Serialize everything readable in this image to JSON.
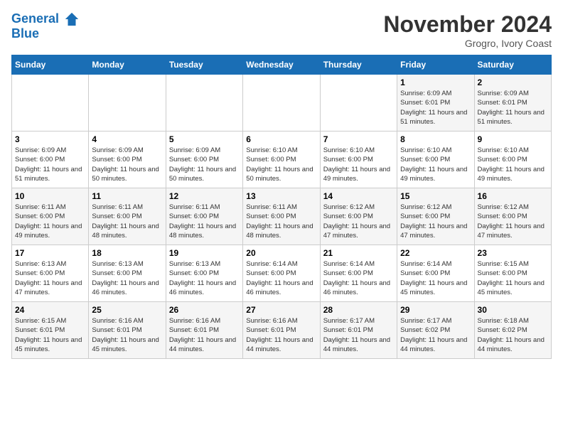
{
  "logo": {
    "line1": "General",
    "line2": "Blue"
  },
  "title": "November 2024",
  "subtitle": "Grogro, Ivory Coast",
  "days_of_week": [
    "Sunday",
    "Monday",
    "Tuesday",
    "Wednesday",
    "Thursday",
    "Friday",
    "Saturday"
  ],
  "weeks": [
    [
      {
        "day": "",
        "detail": ""
      },
      {
        "day": "",
        "detail": ""
      },
      {
        "day": "",
        "detail": ""
      },
      {
        "day": "",
        "detail": ""
      },
      {
        "day": "",
        "detail": ""
      },
      {
        "day": "1",
        "detail": "Sunrise: 6:09 AM\nSunset: 6:01 PM\nDaylight: 11 hours and 51 minutes."
      },
      {
        "day": "2",
        "detail": "Sunrise: 6:09 AM\nSunset: 6:01 PM\nDaylight: 11 hours and 51 minutes."
      }
    ],
    [
      {
        "day": "3",
        "detail": "Sunrise: 6:09 AM\nSunset: 6:00 PM\nDaylight: 11 hours and 51 minutes."
      },
      {
        "day": "4",
        "detail": "Sunrise: 6:09 AM\nSunset: 6:00 PM\nDaylight: 11 hours and 50 minutes."
      },
      {
        "day": "5",
        "detail": "Sunrise: 6:09 AM\nSunset: 6:00 PM\nDaylight: 11 hours and 50 minutes."
      },
      {
        "day": "6",
        "detail": "Sunrise: 6:10 AM\nSunset: 6:00 PM\nDaylight: 11 hours and 50 minutes."
      },
      {
        "day": "7",
        "detail": "Sunrise: 6:10 AM\nSunset: 6:00 PM\nDaylight: 11 hours and 49 minutes."
      },
      {
        "day": "8",
        "detail": "Sunrise: 6:10 AM\nSunset: 6:00 PM\nDaylight: 11 hours and 49 minutes."
      },
      {
        "day": "9",
        "detail": "Sunrise: 6:10 AM\nSunset: 6:00 PM\nDaylight: 11 hours and 49 minutes."
      }
    ],
    [
      {
        "day": "10",
        "detail": "Sunrise: 6:11 AM\nSunset: 6:00 PM\nDaylight: 11 hours and 49 minutes."
      },
      {
        "day": "11",
        "detail": "Sunrise: 6:11 AM\nSunset: 6:00 PM\nDaylight: 11 hours and 48 minutes."
      },
      {
        "day": "12",
        "detail": "Sunrise: 6:11 AM\nSunset: 6:00 PM\nDaylight: 11 hours and 48 minutes."
      },
      {
        "day": "13",
        "detail": "Sunrise: 6:11 AM\nSunset: 6:00 PM\nDaylight: 11 hours and 48 minutes."
      },
      {
        "day": "14",
        "detail": "Sunrise: 6:12 AM\nSunset: 6:00 PM\nDaylight: 11 hours and 47 minutes."
      },
      {
        "day": "15",
        "detail": "Sunrise: 6:12 AM\nSunset: 6:00 PM\nDaylight: 11 hours and 47 minutes."
      },
      {
        "day": "16",
        "detail": "Sunrise: 6:12 AM\nSunset: 6:00 PM\nDaylight: 11 hours and 47 minutes."
      }
    ],
    [
      {
        "day": "17",
        "detail": "Sunrise: 6:13 AM\nSunset: 6:00 PM\nDaylight: 11 hours and 47 minutes."
      },
      {
        "day": "18",
        "detail": "Sunrise: 6:13 AM\nSunset: 6:00 PM\nDaylight: 11 hours and 46 minutes."
      },
      {
        "day": "19",
        "detail": "Sunrise: 6:13 AM\nSunset: 6:00 PM\nDaylight: 11 hours and 46 minutes."
      },
      {
        "day": "20",
        "detail": "Sunrise: 6:14 AM\nSunset: 6:00 PM\nDaylight: 11 hours and 46 minutes."
      },
      {
        "day": "21",
        "detail": "Sunrise: 6:14 AM\nSunset: 6:00 PM\nDaylight: 11 hours and 46 minutes."
      },
      {
        "day": "22",
        "detail": "Sunrise: 6:14 AM\nSunset: 6:00 PM\nDaylight: 11 hours and 45 minutes."
      },
      {
        "day": "23",
        "detail": "Sunrise: 6:15 AM\nSunset: 6:00 PM\nDaylight: 11 hours and 45 minutes."
      }
    ],
    [
      {
        "day": "24",
        "detail": "Sunrise: 6:15 AM\nSunset: 6:01 PM\nDaylight: 11 hours and 45 minutes."
      },
      {
        "day": "25",
        "detail": "Sunrise: 6:16 AM\nSunset: 6:01 PM\nDaylight: 11 hours and 45 minutes."
      },
      {
        "day": "26",
        "detail": "Sunrise: 6:16 AM\nSunset: 6:01 PM\nDaylight: 11 hours and 44 minutes."
      },
      {
        "day": "27",
        "detail": "Sunrise: 6:16 AM\nSunset: 6:01 PM\nDaylight: 11 hours and 44 minutes."
      },
      {
        "day": "28",
        "detail": "Sunrise: 6:17 AM\nSunset: 6:01 PM\nDaylight: 11 hours and 44 minutes."
      },
      {
        "day": "29",
        "detail": "Sunrise: 6:17 AM\nSunset: 6:02 PM\nDaylight: 11 hours and 44 minutes."
      },
      {
        "day": "30",
        "detail": "Sunrise: 6:18 AM\nSunset: 6:02 PM\nDaylight: 11 hours and 44 minutes."
      }
    ]
  ]
}
